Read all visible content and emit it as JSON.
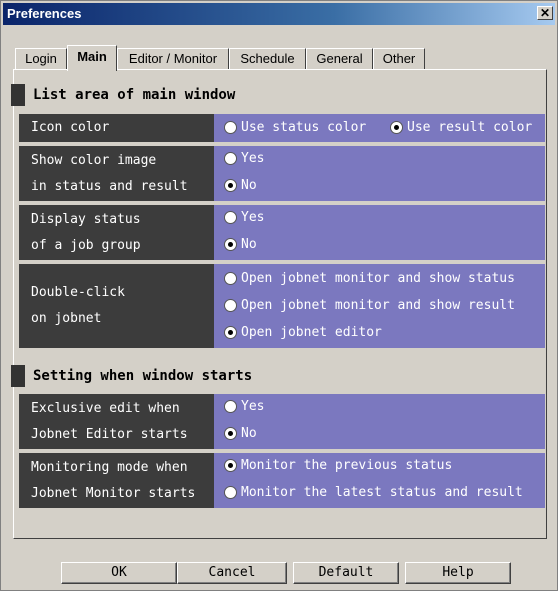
{
  "window": {
    "title": "Preferences",
    "close_glyph": "✕"
  },
  "tabs": [
    {
      "label": "Login",
      "active": false
    },
    {
      "label": "Main",
      "active": true
    },
    {
      "label": "Editor / Monitor",
      "active": false
    },
    {
      "label": "Schedule",
      "active": false
    },
    {
      "label": "General",
      "active": false
    },
    {
      "label": "Other",
      "active": false
    }
  ],
  "colors": {
    "label_bg": "#3c3c3c",
    "option_bg": "#7b78bf",
    "titlebar": "#0a246a"
  },
  "sections": [
    {
      "header": "List area of main window",
      "rows": [
        {
          "label": "Icon color",
          "options": [
            "Use status color",
            "Use result color"
          ],
          "selected": 1
        },
        {
          "label": "Show color image\nin status and result",
          "options": [
            "Yes",
            "No"
          ],
          "selected": 1
        },
        {
          "label": "Display status\nof a job group",
          "options": [
            "Yes",
            "No"
          ],
          "selected": 1
        },
        {
          "label": "Double-click\non jobnet",
          "options": [
            "Open jobnet monitor and show status",
            "Open jobnet monitor and show result",
            "Open jobnet editor"
          ],
          "selected": 2
        }
      ]
    },
    {
      "header": "Setting when window starts",
      "rows": [
        {
          "label": "Exclusive edit when\nJobnet Editor starts",
          "options": [
            "Yes",
            "No"
          ],
          "selected": 1
        },
        {
          "label": "Monitoring mode when\nJobnet Monitor starts",
          "options": [
            "Monitor the previous status",
            "Monitor the latest status and result"
          ],
          "selected": 0
        }
      ]
    }
  ],
  "buttons": {
    "ok": "OK",
    "cancel": "Cancel",
    "default": "Default",
    "help": "Help"
  }
}
